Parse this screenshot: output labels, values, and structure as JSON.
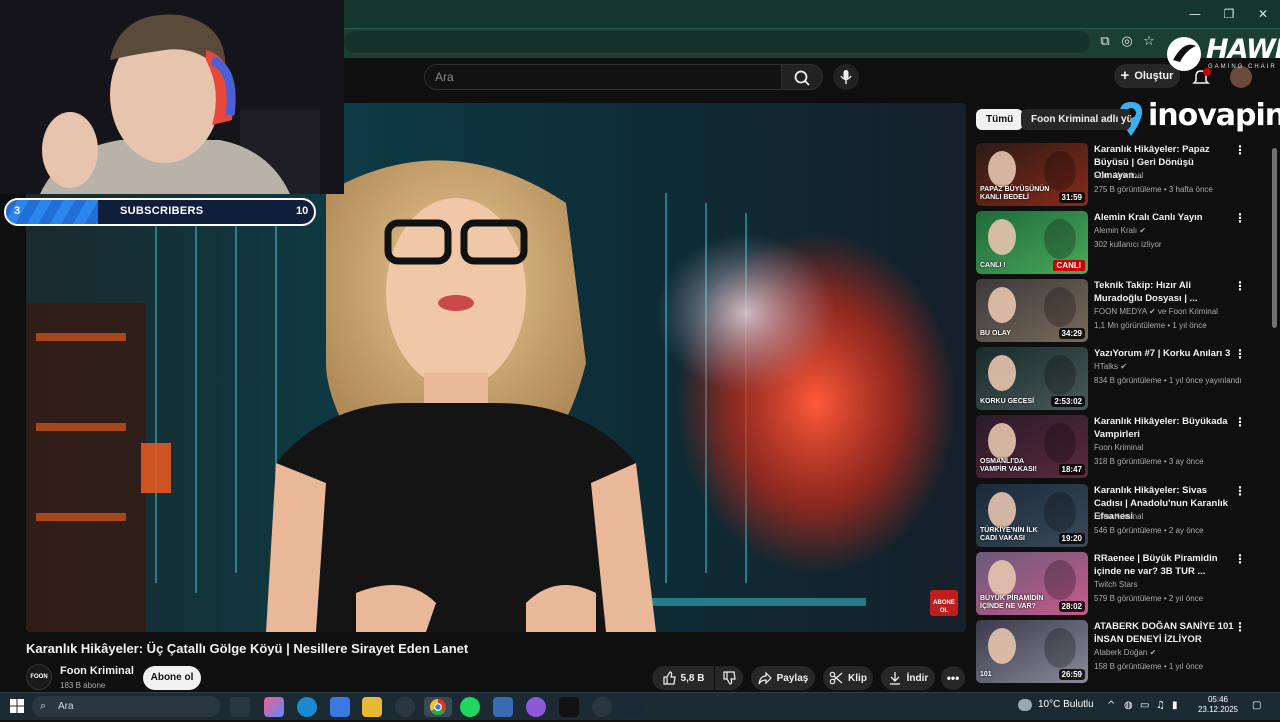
{
  "window_controls": {
    "minimize": "—",
    "maximize": "❐",
    "close": "✕"
  },
  "search": {
    "placeholder": "Ara"
  },
  "topbar": {
    "create_label": "Oluştur"
  },
  "overlays": {
    "hawk_logo": "HAWK",
    "hawk_sub": "GAMING CHAIR",
    "inova_logo": "inovapin",
    "subscriber_goal": {
      "label": "SUBSCRIBERS",
      "min": "3",
      "max": "10",
      "progress": 0.3
    }
  },
  "chips": [
    {
      "label": "Tümü"
    },
    {
      "label": "Foon Kriminal adlı yük"
    }
  ],
  "video": {
    "title": "Karanlık Hikâyeler: Üç Çatallı Gölge Köyü | Nesillere Sirayet Eden Lanet",
    "abone_badge": "ABONE OL",
    "channel": {
      "name": "Foon Kriminal",
      "subs": "183 B abone",
      "avatar_text": "FOON"
    },
    "subscribe_label": "Abone ol",
    "likes": "5,8 B",
    "share_label": "Paylaş",
    "clip_label": "Klip",
    "download_label": "İndir"
  },
  "recommendations": [
    {
      "title": "Karanlık Hikâyeler: Papaz Büyüsü | Geri Dönüşü Olmayan...",
      "channel": "Foon Kriminal",
      "meta": "275 B görüntüleme • 3 hafta önce",
      "duration": "31:59",
      "thumb_text": "PAPAZ BÜYÜSÜNÜN KANLI BEDELİ",
      "colors": [
        "#2b1a14",
        "#8a2a1a"
      ]
    },
    {
      "title": "Alemin Kralı Canlı Yayın",
      "channel": "Alemin Kralı ✔",
      "meta": "302 kullanıcı izliyor",
      "live": "CANLI",
      "thumb_text": "CANLI !",
      "colors": [
        "#1f6a3a",
        "#4aa85a"
      ]
    },
    {
      "title": "Teknik Takip: Hızır Ali Muradoğlu Dosyası | ...",
      "channel": "FOON MEDYA ✔ ve Foon Kriminal",
      "meta": "1,1 Mn görüntüleme • 1 yıl önce",
      "duration": "34:29",
      "thumb_text": "BU OLAY",
      "colors": [
        "#3a3a3a",
        "#7a6a5a"
      ]
    },
    {
      "title": "YazıYorum #7 | Korku Anıları 3",
      "channel": "HTalks ✔",
      "meta": "834 B görüntüleme • 1 yıl önce yayınlandı",
      "duration": "2:53:02",
      "thumb_text": "KORKU GECESİ",
      "colors": [
        "#1a2a2a",
        "#4a5a5a"
      ]
    },
    {
      "title": "Karanlık Hikâyeler: Büyükada Vampirleri",
      "channel": "Foon Kriminal",
      "meta": "318 B görüntüleme • 3 ay önce",
      "duration": "18:47",
      "thumb_text": "OSMANLI'DA VAMPİR VAKASI!",
      "colors": [
        "#2a1a2a",
        "#5a2a3a"
      ]
    },
    {
      "title": "Karanlık Hikâyeler: Sivas Cadısı | Anadolu'nun Karanlık Efsanesi",
      "channel": "Foon Kriminal",
      "meta": "546 B görüntüleme • 2 ay önce",
      "duration": "19:20",
      "thumb_text": "TÜRKİYE'NİN İLK CADI VAKASI",
      "colors": [
        "#1a2a3a",
        "#3a4a5a"
      ]
    },
    {
      "title": "RRaenee | Büyük Piramidin içinde ne var? 3B TUR ...",
      "channel": "Twitch Stars",
      "meta": "579 B görüntüleme • 2 yıl önce",
      "duration": "28:02",
      "thumb_text": "BÜYÜK PİRAMİDİN İÇİNDE NE VAR?",
      "colors": [
        "#6a5a7a",
        "#c85a8a"
      ]
    },
    {
      "title": "ATABERK DOĞAN SANİYE 101 İNSAN DENEYİ İZLİYOR",
      "channel": "Ataberk Doğan ✔",
      "meta": "158 B görüntüleme • 1 yıl önce",
      "duration": "26:59",
      "thumb_text": "101",
      "colors": [
        "#3a3a4a",
        "#8a8a9a"
      ]
    }
  ],
  "taskbar": {
    "search_placeholder": "Ara",
    "weather": "10°C  Bulutlu",
    "time": "05:46",
    "date": "23.12.2025"
  }
}
